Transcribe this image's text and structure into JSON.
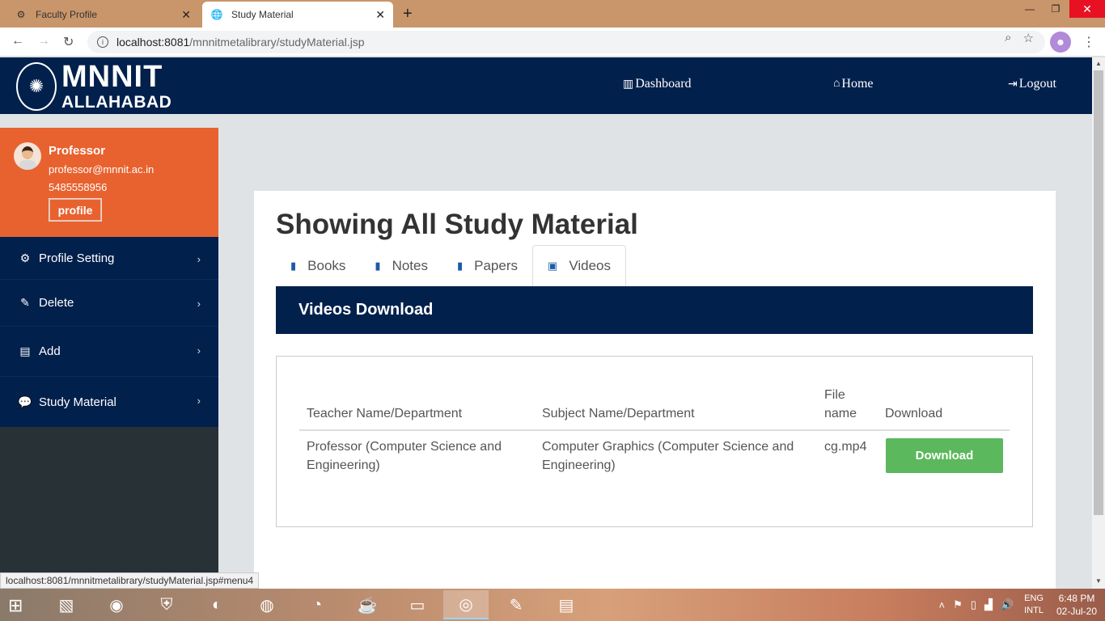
{
  "browser": {
    "tabs": [
      {
        "title": "Faculty Profile",
        "active": false
      },
      {
        "title": "Study Material",
        "active": true
      }
    ],
    "url_host": "localhost:8081",
    "url_path": "/mnnitmetalibrary/studyMaterial.jsp",
    "status_url": "localhost:8081/mnnitmetalibrary/studyMaterial.jsp#menu4"
  },
  "header": {
    "logo_line1": "MNNIT",
    "logo_line2": "ALLAHABAD",
    "nav": [
      {
        "label": "Dashboard",
        "icon": "bar-chart-icon"
      },
      {
        "label": "Home",
        "icon": "home-icon"
      },
      {
        "label": "Logout",
        "icon": "logout-icon"
      }
    ]
  },
  "sidebar": {
    "profile": {
      "name": "Professor",
      "email": "professor@mnnit.ac.in",
      "phone": "5485558956",
      "button": "profile"
    },
    "items": [
      {
        "label": "Profile Setting",
        "icon": "cogs-icon"
      },
      {
        "label": "Delete",
        "icon": "pencil-icon"
      },
      {
        "label": "Add",
        "icon": "book-icon"
      },
      {
        "label": "Study Material",
        "icon": "comments-icon"
      }
    ]
  },
  "main": {
    "title": "Showing All Study Material",
    "tabs": [
      {
        "label": "Books",
        "icon": "book-icon",
        "active": false
      },
      {
        "label": "Notes",
        "icon": "book-icon",
        "active": false
      },
      {
        "label": "Papers",
        "icon": "book-icon",
        "active": false
      },
      {
        "label": "Videos",
        "icon": "image-icon",
        "active": true
      }
    ],
    "section_title": "Videos Download",
    "table": {
      "headers": [
        "Teacher Name/Department",
        "Subject Name/Department",
        "File name",
        "Download"
      ],
      "rows": [
        {
          "teacher": "Professor (Computer Science and Engineering)",
          "subject": "Computer Graphics (Computer Science and Engineering)",
          "file": "cg.mp4",
          "action": "Download"
        }
      ]
    }
  },
  "taskbar": {
    "lang1": "ENG",
    "lang2": "INTL",
    "time": "6:48 PM",
    "date": "02-Jul-20"
  }
}
